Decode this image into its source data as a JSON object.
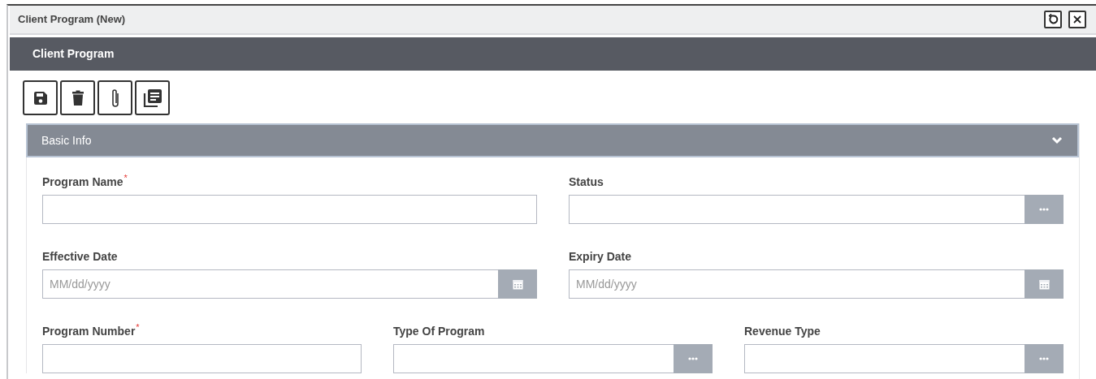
{
  "window": {
    "title": "Client Program (New)",
    "controls": [
      {
        "kind": "restore"
      },
      {
        "kind": "close"
      }
    ]
  },
  "header": {
    "title": "Client Program"
  },
  "toolbar": [
    {
      "kind": "save"
    },
    {
      "kind": "delete"
    },
    {
      "kind": "attach"
    },
    {
      "kind": "notes"
    }
  ],
  "section": {
    "title": "Basic Info",
    "expanded": true,
    "required_mark": "*",
    "rows": [
      [
        {
          "label": "Program Name",
          "required": true,
          "kind": "text"
        },
        {
          "label": "Status",
          "required": false,
          "kind": "lookup"
        }
      ],
      [
        {
          "label": "Effective Date",
          "required": false,
          "kind": "date",
          "placeholder": "MM/dd/yyyy"
        },
        {
          "label": "Expiry Date",
          "required": false,
          "kind": "date",
          "placeholder": "MM/dd/yyyy"
        }
      ],
      [
        {
          "label": "Program Number",
          "required": true,
          "kind": "text"
        },
        {
          "label": "Type Of Program",
          "required": false,
          "kind": "lookup"
        },
        {
          "label": "Revenue Type",
          "required": false,
          "kind": "lookup"
        }
      ]
    ]
  }
}
